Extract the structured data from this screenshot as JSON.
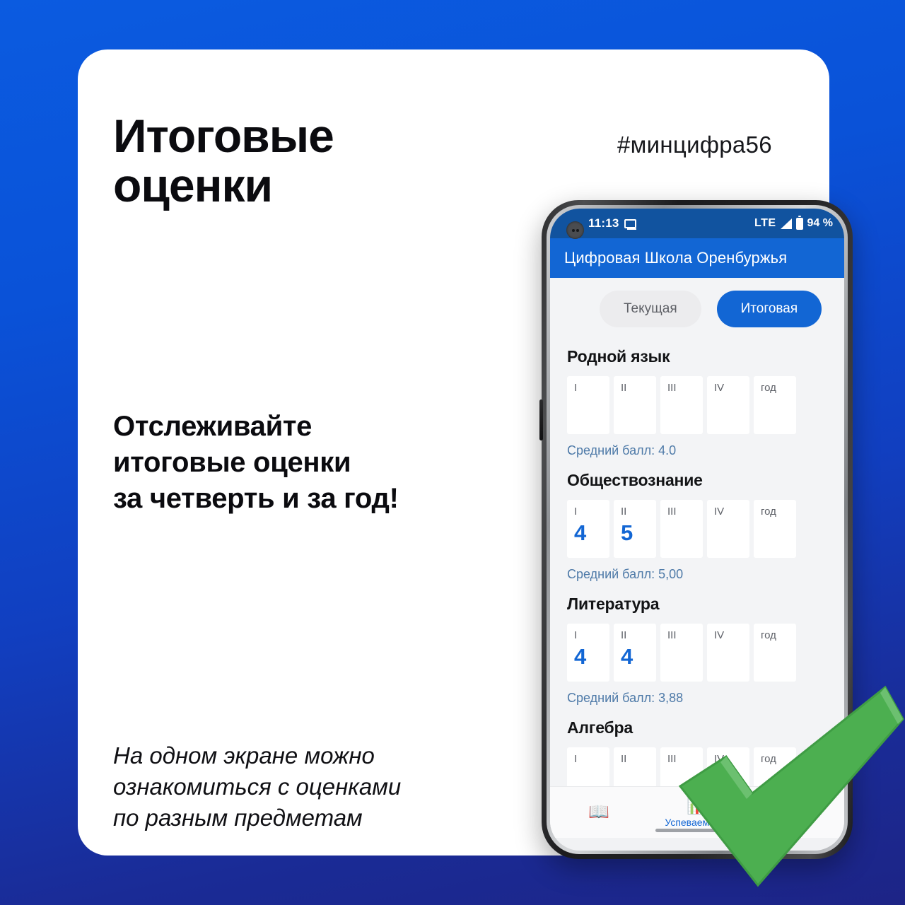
{
  "poster": {
    "headline": "Итоговые\nоценки",
    "hashtag": "#минцифра56",
    "body_copy": "Отслеживайте\nитоговые оценки\nза четверть и за год!",
    "footnote": "На одном экране можно\nознакомиться с оценками\nпо разным предметам",
    "background_color_top": "#0B5BE0",
    "background_color_bottom": "#1D2486",
    "card_color": "#FFFFFF",
    "checkmark_color": "#4CAF50"
  },
  "phone": {
    "status_bar": {
      "time": "11:13",
      "cast_icon": "screen-cast-icon",
      "network": "LTE",
      "signal_icon": "signal-bars-icon",
      "battery_icon": "battery-icon",
      "battery_percent": "94 %"
    },
    "app_bar": {
      "title": "Цифровая Школа Оренбуржья",
      "color": "#1266D4"
    },
    "tabs": [
      {
        "label": "Текущая",
        "active": false
      },
      {
        "label": "Итоговая",
        "active": true
      }
    ],
    "column_headers": [
      "I",
      "II",
      "III",
      "IV",
      "год"
    ],
    "subjects": [
      {
        "name": "Родной язык",
        "grades": [
          "",
          "",
          "",
          "",
          ""
        ],
        "average_label": "Средний балл: 4.0"
      },
      {
        "name": "Обществознание",
        "grades": [
          "4",
          "5",
          "",
          "",
          ""
        ],
        "average_label": "Средний балл: 5,00"
      },
      {
        "name": "Литература",
        "grades": [
          "4",
          "4",
          "",
          "",
          ""
        ],
        "average_label": "Средний балл: 3,88"
      },
      {
        "name": "Алгебра",
        "grades": [
          "",
          "",
          "",
          "",
          ""
        ],
        "average_label": ""
      }
    ],
    "bottom_nav": [
      {
        "label": "",
        "icon": "book-icon",
        "active": false
      },
      {
        "label": "Успеваемость",
        "icon": "chart-icon",
        "active": true
      },
      {
        "label": "",
        "icon": "person-icon",
        "active": false
      }
    ]
  }
}
